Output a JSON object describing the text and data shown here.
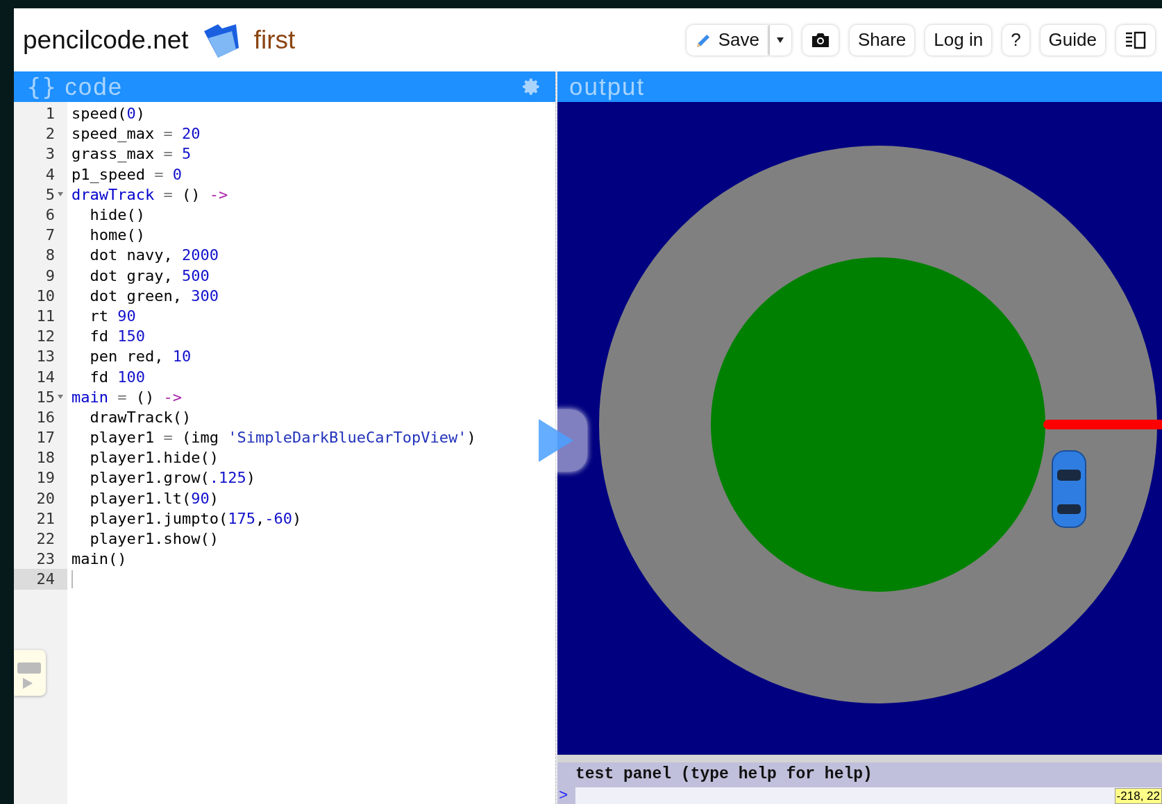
{
  "header": {
    "site": "pencilcode.net",
    "filename": "first",
    "buttons": [
      {
        "kind": "save",
        "label": "Save"
      },
      {
        "kind": "dropdown"
      },
      {
        "kind": "camera"
      },
      {
        "kind": "text",
        "label": "Share"
      },
      {
        "kind": "text",
        "label": "Log in"
      },
      {
        "kind": "text",
        "label": "?"
      },
      {
        "kind": "text",
        "label": "Guide"
      },
      {
        "kind": "layout"
      }
    ]
  },
  "code_panel": {
    "braces": "{}",
    "title": "code",
    "lines": [
      {
        "number": "1",
        "foldable": false,
        "active": false,
        "segments": [
          {
            "kind": "plain",
            "text": "speed("
          },
          {
            "kind": "number",
            "text": "0"
          },
          {
            "kind": "plain",
            "text": ")"
          }
        ]
      },
      {
        "number": "2",
        "foldable": false,
        "active": false,
        "segments": [
          {
            "kind": "plain",
            "text": "speed_max"
          },
          {
            "kind": "operator",
            "text": " = "
          },
          {
            "kind": "number",
            "text": "20"
          }
        ]
      },
      {
        "number": "3",
        "foldable": false,
        "active": false,
        "segments": [
          {
            "kind": "plain",
            "text": "grass_max"
          },
          {
            "kind": "operator",
            "text": " = "
          },
          {
            "kind": "number",
            "text": "5"
          }
        ]
      },
      {
        "number": "4",
        "foldable": false,
        "active": false,
        "segments": [
          {
            "kind": "plain",
            "text": "p1_speed"
          },
          {
            "kind": "operator",
            "text": " = "
          },
          {
            "kind": "number",
            "text": "0"
          }
        ]
      },
      {
        "number": "5",
        "foldable": true,
        "active": false,
        "segments": [
          {
            "kind": "def",
            "text": "drawTrack"
          },
          {
            "kind": "operator",
            "text": " = "
          },
          {
            "kind": "plain",
            "text": "() "
          },
          {
            "kind": "arrow",
            "text": "->"
          }
        ]
      },
      {
        "number": "6",
        "foldable": false,
        "active": false,
        "segments": [
          {
            "kind": "plain",
            "text": "  hide()"
          }
        ]
      },
      {
        "number": "7",
        "foldable": false,
        "active": false,
        "segments": [
          {
            "kind": "plain",
            "text": "  home()"
          }
        ]
      },
      {
        "number": "8",
        "foldable": false,
        "active": false,
        "segments": [
          {
            "kind": "plain",
            "text": "  dot navy, "
          },
          {
            "kind": "number",
            "text": "2000"
          }
        ]
      },
      {
        "number": "9",
        "foldable": false,
        "active": false,
        "segments": [
          {
            "kind": "plain",
            "text": "  dot gray, "
          },
          {
            "kind": "number",
            "text": "500"
          }
        ]
      },
      {
        "number": "10",
        "foldable": false,
        "active": false,
        "segments": [
          {
            "kind": "plain",
            "text": "  dot green, "
          },
          {
            "kind": "number",
            "text": "300"
          }
        ]
      },
      {
        "number": "11",
        "foldable": false,
        "active": false,
        "segments": [
          {
            "kind": "plain",
            "text": "  rt "
          },
          {
            "kind": "number",
            "text": "90"
          }
        ]
      },
      {
        "number": "12",
        "foldable": false,
        "active": false,
        "segments": [
          {
            "kind": "plain",
            "text": "  fd "
          },
          {
            "kind": "number",
            "text": "150"
          }
        ]
      },
      {
        "number": "13",
        "foldable": false,
        "active": false,
        "segments": [
          {
            "kind": "plain",
            "text": "  pen red, "
          },
          {
            "kind": "number",
            "text": "10"
          }
        ]
      },
      {
        "number": "14",
        "foldable": false,
        "active": false,
        "segments": [
          {
            "kind": "plain",
            "text": "  fd "
          },
          {
            "kind": "number",
            "text": "100"
          }
        ]
      },
      {
        "number": "15",
        "foldable": true,
        "active": false,
        "segments": [
          {
            "kind": "def",
            "text": "main"
          },
          {
            "kind": "operator",
            "text": " = "
          },
          {
            "kind": "plain",
            "text": "() "
          },
          {
            "kind": "arrow",
            "text": "->"
          }
        ]
      },
      {
        "number": "16",
        "foldable": false,
        "active": false,
        "segments": [
          {
            "kind": "plain",
            "text": "  drawTrack()"
          }
        ]
      },
      {
        "number": "17",
        "foldable": false,
        "active": false,
        "segments": [
          {
            "kind": "plain",
            "text": "  player1"
          },
          {
            "kind": "operator",
            "text": " = "
          },
          {
            "kind": "plain",
            "text": "(img "
          },
          {
            "kind": "string",
            "text": "'SimpleDarkBlueCarTopView'"
          },
          {
            "kind": "plain",
            "text": ")"
          }
        ]
      },
      {
        "number": "18",
        "foldable": false,
        "active": false,
        "segments": [
          {
            "kind": "plain",
            "text": "  player1.hide()"
          }
        ]
      },
      {
        "number": "19",
        "foldable": false,
        "active": false,
        "segments": [
          {
            "kind": "plain",
            "text": "  player1.grow("
          },
          {
            "kind": "number",
            "text": ".125"
          },
          {
            "kind": "plain",
            "text": ")"
          }
        ]
      },
      {
        "number": "20",
        "foldable": false,
        "active": false,
        "segments": [
          {
            "kind": "plain",
            "text": "  player1.lt("
          },
          {
            "kind": "number",
            "text": "90"
          },
          {
            "kind": "plain",
            "text": ")"
          }
        ]
      },
      {
        "number": "21",
        "foldable": false,
        "active": false,
        "segments": [
          {
            "kind": "plain",
            "text": "  player1.jumpto("
          },
          {
            "kind": "number",
            "text": "175"
          },
          {
            "kind": "plain",
            "text": ","
          },
          {
            "kind": "number",
            "text": "-60"
          },
          {
            "kind": "plain",
            "text": ")"
          }
        ]
      },
      {
        "number": "22",
        "foldable": false,
        "active": false,
        "segments": [
          {
            "kind": "plain",
            "text": "  player1.show()"
          }
        ]
      },
      {
        "number": "23",
        "foldable": false,
        "active": false,
        "segments": [
          {
            "kind": "plain",
            "text": "main()"
          }
        ]
      },
      {
        "number": "24",
        "foldable": false,
        "active": true
      }
    ]
  },
  "output_panel": {
    "title": "output",
    "test_panel": {
      "title": "test panel (type help for help)",
      "prompt": ">",
      "coordinates": "-218, 22"
    }
  }
}
